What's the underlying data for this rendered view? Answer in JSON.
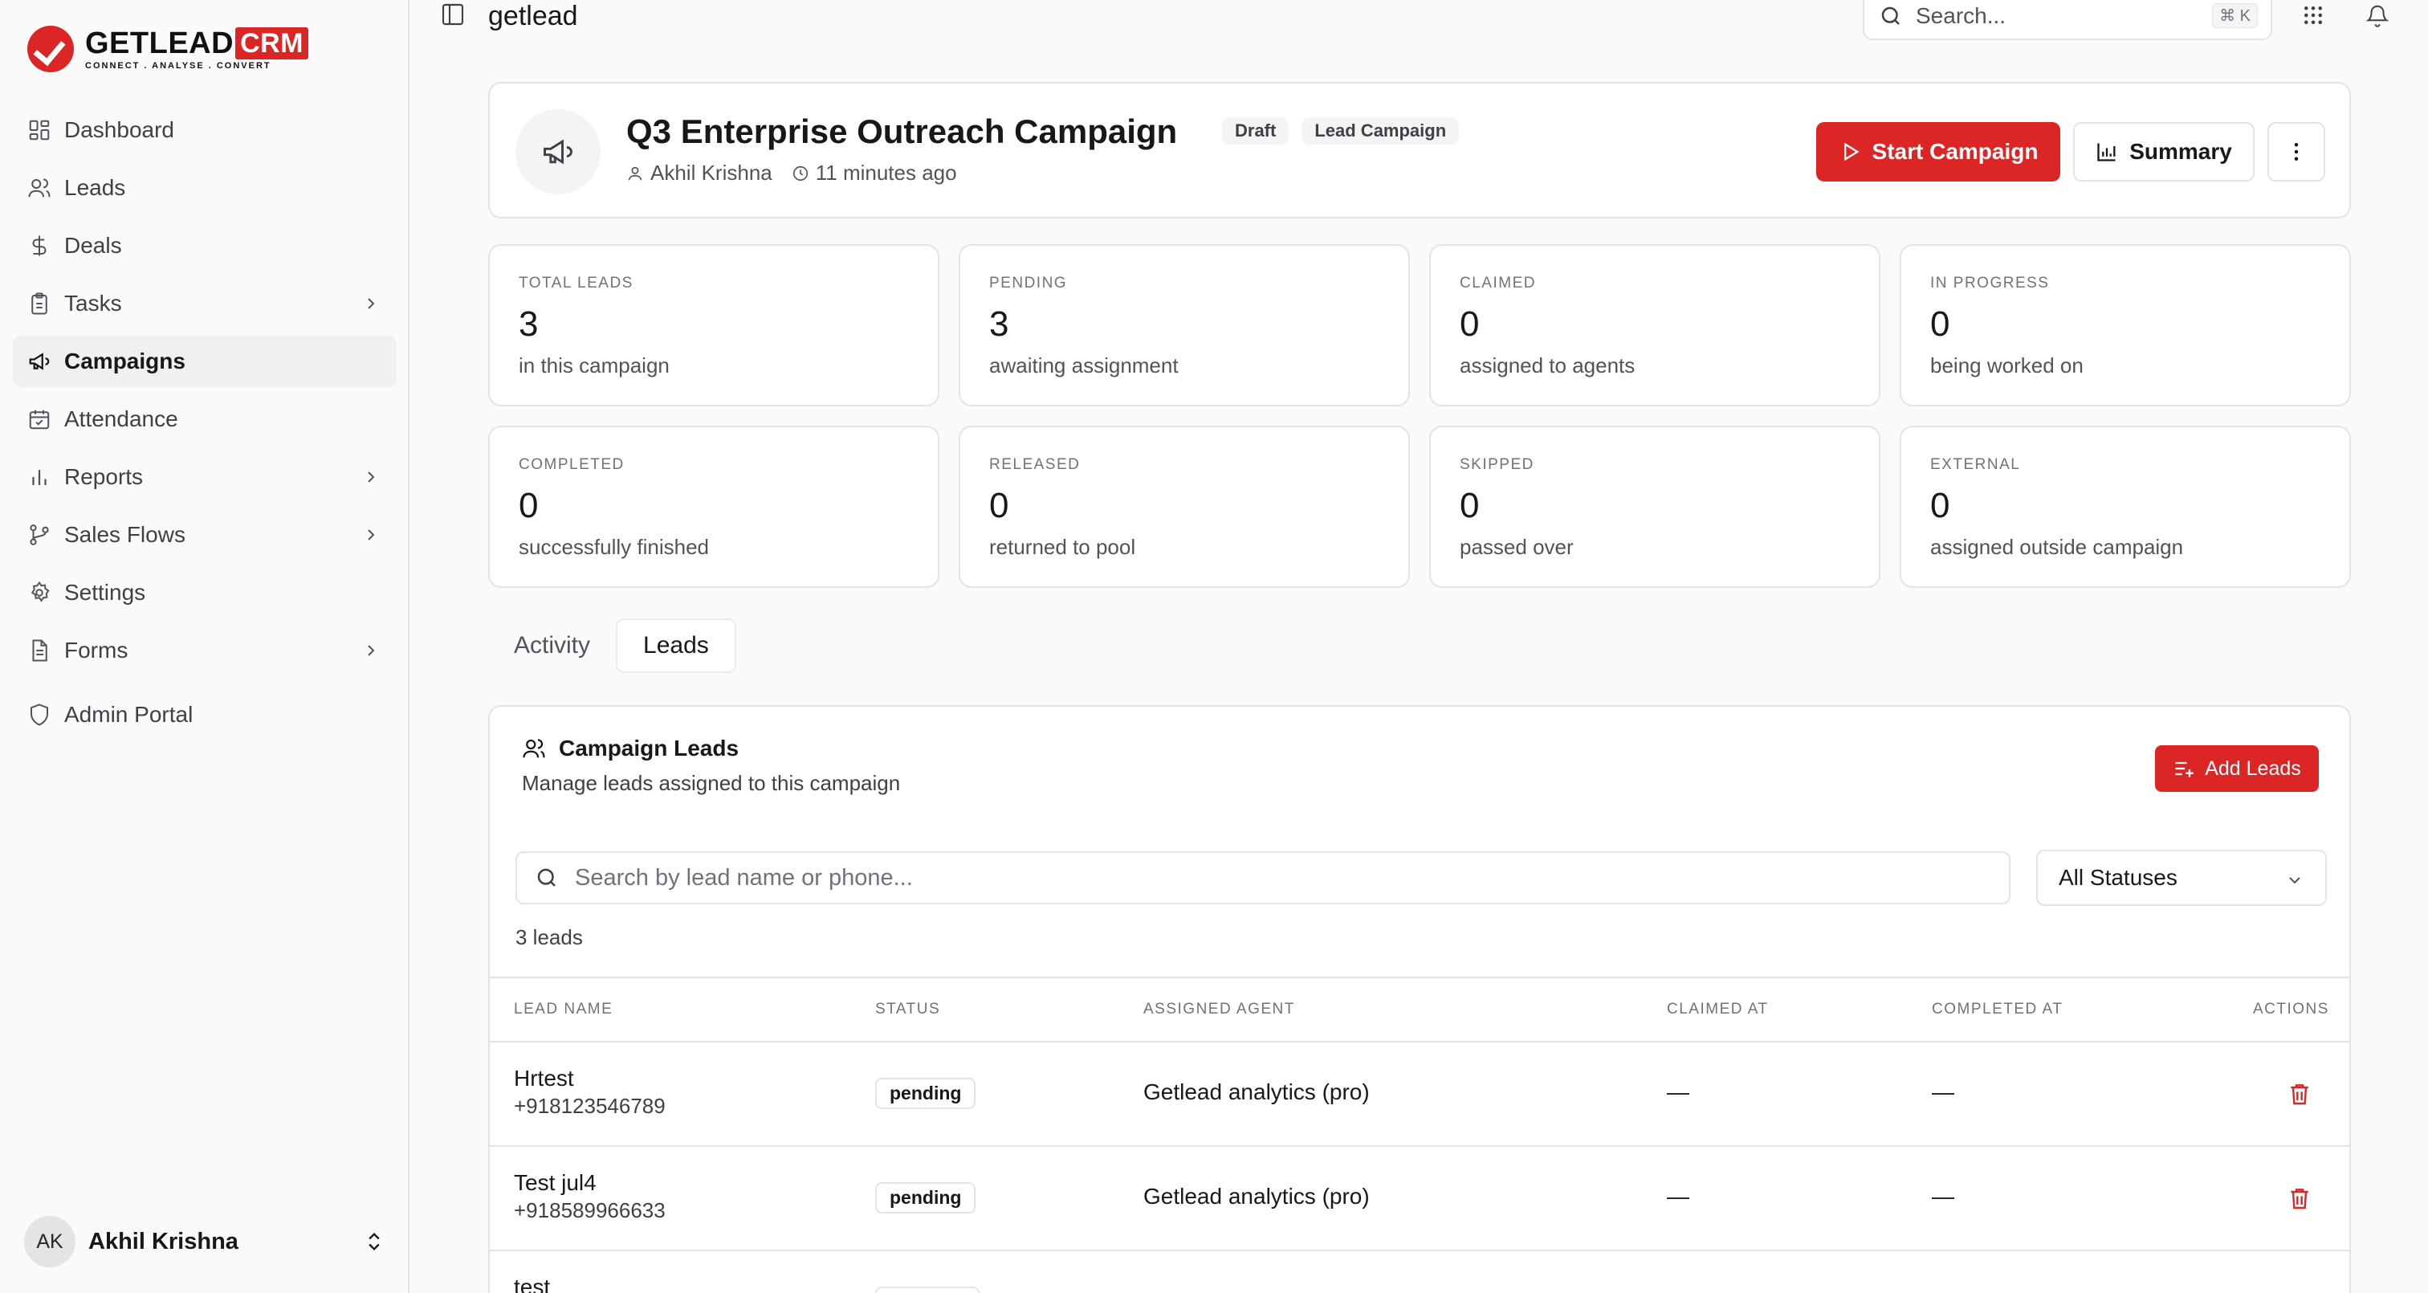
{
  "brand": {
    "name": "GETLEAD",
    "suffix": "CRM",
    "tagline": "CONNECT  .  ANALYSE  .  CONVERT",
    "accent": "#dc2626"
  },
  "sidebar": {
    "items": [
      {
        "label": "Dashboard",
        "icon": "grid-icon"
      },
      {
        "label": "Leads",
        "icon": "users-icon"
      },
      {
        "label": "Deals",
        "icon": "dollar-icon"
      },
      {
        "label": "Tasks",
        "icon": "clipboard-icon"
      },
      {
        "label": "Campaigns",
        "icon": "megaphone-icon"
      },
      {
        "label": "Attendance",
        "icon": "calendar-check-icon"
      },
      {
        "label": "Reports",
        "icon": "bar-chart-icon"
      },
      {
        "label": "Sales Flows",
        "icon": "git-branch-icon"
      },
      {
        "label": "Settings",
        "icon": "gear-icon"
      },
      {
        "label": "Forms",
        "icon": "document-icon"
      },
      {
        "label": "Admin Portal",
        "icon": "shield-icon"
      }
    ],
    "user": {
      "initials": "AK",
      "name": "Akhil Krishna"
    }
  },
  "topbar": {
    "workspace": "getlead",
    "search_placeholder": "Search...",
    "shortcut": "⌘ K"
  },
  "campaign": {
    "title": "Q3 Enterprise Outreach Campaign",
    "badges": [
      "Draft",
      "Lead Campaign"
    ],
    "owner": "Akhil Krishna",
    "updated": "11 minutes ago",
    "start_label": "Start Campaign",
    "summary_label": "Summary"
  },
  "stats": [
    {
      "label": "TOTAL LEADS",
      "value": "3",
      "sub": "in this campaign"
    },
    {
      "label": "PENDING",
      "value": "3",
      "sub": "awaiting assignment"
    },
    {
      "label": "CLAIMED",
      "value": "0",
      "sub": "assigned to agents"
    },
    {
      "label": "IN PROGRESS",
      "value": "0",
      "sub": "being worked on"
    },
    {
      "label": "COMPLETED",
      "value": "0",
      "sub": "successfully finished"
    },
    {
      "label": "RELEASED",
      "value": "0",
      "sub": "returned to pool"
    },
    {
      "label": "SKIPPED",
      "value": "0",
      "sub": "passed over"
    },
    {
      "label": "EXTERNAL",
      "value": "0",
      "sub": "assigned outside campaign"
    }
  ],
  "tabs": [
    "Activity",
    "Leads"
  ],
  "leads_panel": {
    "title": "Campaign Leads",
    "description": "Manage leads assigned to this campaign",
    "add_label": "Add Leads",
    "search_placeholder": "Search by lead name or phone...",
    "status_filter": "All Statuses",
    "count_text": "3 leads",
    "columns": [
      "LEAD NAME",
      "STATUS",
      "ASSIGNED AGENT",
      "CLAIMED AT",
      "COMPLETED AT",
      "ACTIONS"
    ],
    "rows": [
      {
        "name": "Hrtest",
        "phone": "+918123546789",
        "status": "pending",
        "agent": "Getlead analytics (pro)",
        "claimed": "—",
        "completed": "—"
      },
      {
        "name": "Test jul4",
        "phone": "+918589966633",
        "status": "pending",
        "agent": "Getlead analytics (pro)",
        "claimed": "—",
        "completed": "—"
      },
      {
        "name": "test",
        "phone": "",
        "status": "",
        "agent": "",
        "claimed": "",
        "completed": ""
      }
    ]
  }
}
